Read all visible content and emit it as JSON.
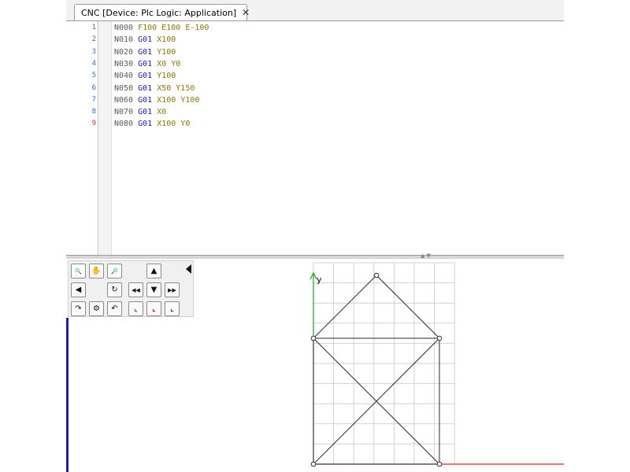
{
  "tab": {
    "title": "CNC [Device: Plc Logic: Application]",
    "close_label": "✕",
    "icon": "cnc-program-icon"
  },
  "editor": {
    "lines": [
      {
        "num": "1",
        "tokens": [
          {
            "t": "N000",
            "k": "n"
          },
          {
            "t": " F100 E100 E-100",
            "k": "p"
          }
        ]
      },
      {
        "num": "2",
        "tokens": [
          {
            "t": "N010 ",
            "k": "n"
          },
          {
            "t": "G01",
            "k": "g"
          },
          {
            "t": " X100",
            "k": "p"
          }
        ]
      },
      {
        "num": "3",
        "tokens": [
          {
            "t": "N020 ",
            "k": "n"
          },
          {
            "t": "G01",
            "k": "g"
          },
          {
            "t": " Y100",
            "k": "p"
          }
        ]
      },
      {
        "num": "4",
        "tokens": [
          {
            "t": "N030 ",
            "k": "n"
          },
          {
            "t": "G01",
            "k": "g"
          },
          {
            "t": " X0 Y0",
            "k": "p"
          }
        ]
      },
      {
        "num": "5",
        "tokens": [
          {
            "t": "N040 ",
            "k": "n"
          },
          {
            "t": "G01",
            "k": "g"
          },
          {
            "t": " Y100",
            "k": "p"
          }
        ]
      },
      {
        "num": "6",
        "tokens": [
          {
            "t": "N050 ",
            "k": "n"
          },
          {
            "t": "G01",
            "k": "g"
          },
          {
            "t": " X50 Y150",
            "k": "p"
          }
        ]
      },
      {
        "num": "7",
        "tokens": [
          {
            "t": "N060 ",
            "k": "n"
          },
          {
            "t": "G01",
            "k": "g"
          },
          {
            "t": " X100 Y100",
            "k": "p"
          }
        ]
      },
      {
        "num": "8",
        "tokens": [
          {
            "t": "N070 ",
            "k": "n"
          },
          {
            "t": "G01",
            "k": "g"
          },
          {
            "t": " X0",
            "k": "p"
          }
        ]
      },
      {
        "num": "9",
        "tokens": [
          {
            "t": "N080 ",
            "k": "n"
          },
          {
            "t": "G01",
            "k": "g"
          },
          {
            "t": " X100 Y0",
            "k": "p"
          }
        ]
      }
    ]
  },
  "viewer": {
    "y_axis_label": "y",
    "path_points": [
      [
        0,
        0
      ],
      [
        100,
        0
      ],
      [
        100,
        100
      ],
      [
        0,
        0
      ],
      [
        0,
        100
      ],
      [
        50,
        150
      ],
      [
        100,
        100
      ],
      [
        0,
        100
      ],
      [
        100,
        0
      ]
    ],
    "grid": true,
    "axis_colors": {
      "x": "#e02020",
      "y": "#20a020"
    },
    "toolbar_icons": [
      "zoom-in-icon",
      "pan-icon",
      "zoom-out-icon",
      "step-up-icon",
      "step-back-icon",
      "rotate-icon",
      "previous-icon",
      "step-down-icon",
      "next-icon",
      "arc-cw-icon",
      "tool-icon",
      "arc-ccw-icon",
      "view-xy-icon",
      "view-zx-icon",
      "view-yz-icon"
    ]
  },
  "colors": {
    "gcode": "#1a1ac8",
    "params": "#8a7a10",
    "line_numbers": "#3a6cc0"
  }
}
